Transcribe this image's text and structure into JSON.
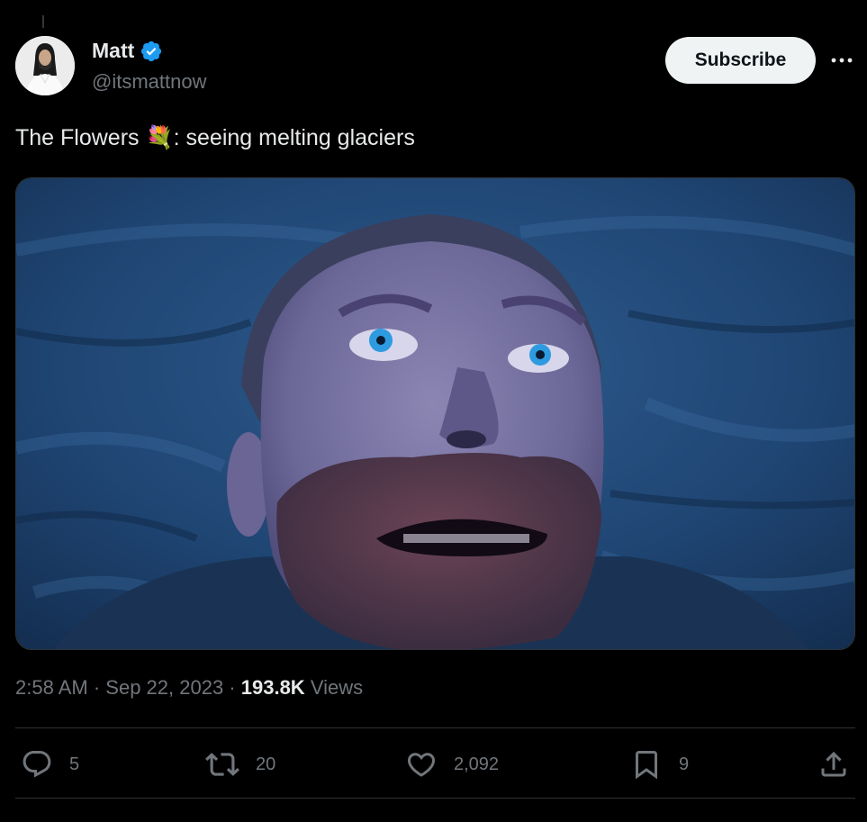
{
  "author": {
    "name": "Matt",
    "handle": "@itsmattnow",
    "verified": true,
    "badge_color": "#1d9bf0"
  },
  "subscribe_label": "Subscribe",
  "tweet": {
    "text_before": "The Flowers ",
    "emoji": "💐",
    "text_after": ": seeing melting glaciers"
  },
  "media": {
    "description_icon": "video-still"
  },
  "meta": {
    "time": "2:58 AM",
    "sep1": " · ",
    "date": "Sep 22, 2023",
    "sep2": " · ",
    "views_count": "193.8K",
    "views_label": " Views"
  },
  "actions": {
    "replies": "5",
    "reposts": "20",
    "likes": "2,092",
    "bookmarks": "9"
  },
  "colors": {
    "background": "#000000",
    "text": "#e7e9ea",
    "secondary": "#71767b",
    "border": "#2f3336"
  }
}
